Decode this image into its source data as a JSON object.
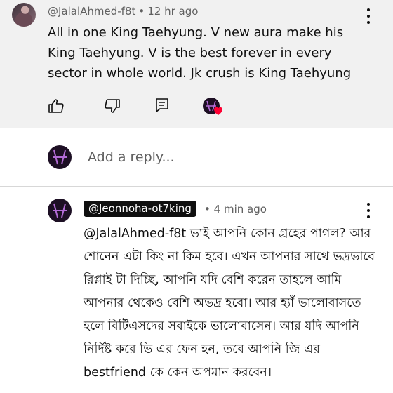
{
  "top_comment": {
    "author": "@JalalAhmed-f8t",
    "separator": "•",
    "time": "12 hr ago",
    "text": "All in one King Taehyung. V new aura make his King Taehyung. V is the best forever in every sector in whole world. Jk crush is King Taehyung"
  },
  "actions": {
    "like_icon": "thumbs-up-icon",
    "dislike_icon": "thumbs-down-icon",
    "reply_icon": "comment-reply-icon",
    "heart_color": "#ff0033"
  },
  "reply_box": {
    "placeholder": "Add a reply..."
  },
  "reply": {
    "author": "@Jeonnoha-ot7king",
    "separator": "•",
    "time": "4 min ago",
    "text": "@JalalAhmed-f8t ভাই আপনি কোন গ্রহের পাগল?  আর শোনেন এটা কিং না কিম হবে।  এখন আপনার সাথে ভদ্রভাবে রিপ্লাই টা দিচ্ছি,  আপনি যদি বেশি করেন তাহলে আমি আপনার থেকেও বেশি অভদ্র হবো।  আর হ্যাঁ ভালোবাসতে হলে বিটিএসদের সবাইকে ভালোবাসেন।  আর যদি আপনি নির্দিষ্ট করে ভি এর ফেন হন,  তবে আপনি জি এর bestfriend কে কেন অপমান করবেন।"
  }
}
